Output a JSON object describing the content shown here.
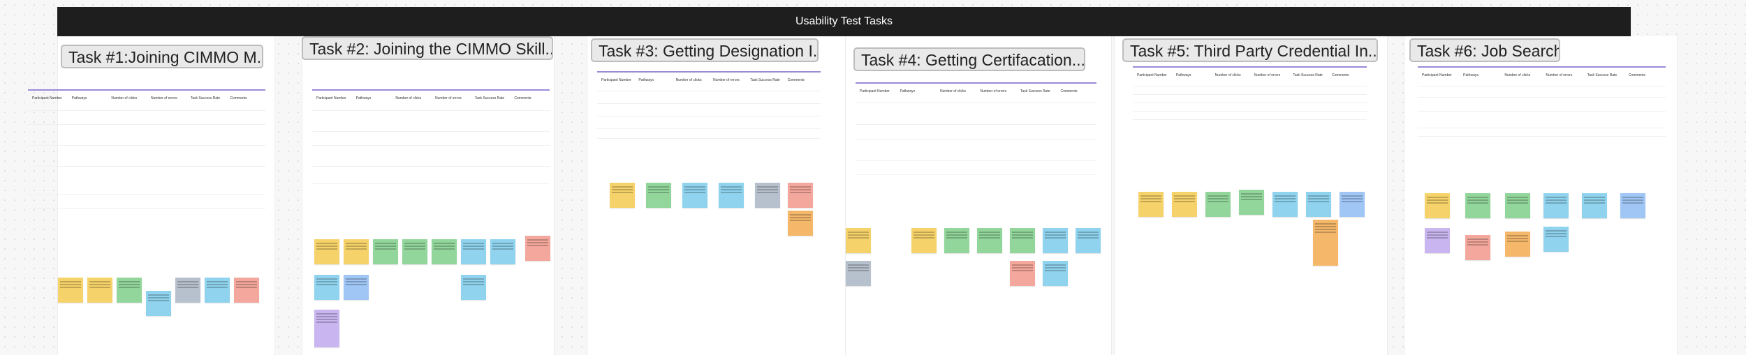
{
  "board": {
    "title": "Usability Test Tasks"
  },
  "tasks": [
    {
      "title": "Task #1:Joining CIMMO M..."
    },
    {
      "title": "Task #2: Joining the CIMMO Skill..."
    },
    {
      "title": "Task #3: Getting Designation I..."
    },
    {
      "title": "Task #4: Getting Certifacation..."
    },
    {
      "title": "Task #5: Third Party Credential In..."
    },
    {
      "title": "Task #6: Job Search"
    }
  ],
  "table_headers": [
    "Participant Number",
    "Pathways",
    "Number of clicks",
    "Number of errors",
    "Task Success Rate",
    "Comments"
  ],
  "colors": {
    "header_bg": "#1e1e1e",
    "table_accent": "#9c8ad8",
    "sticky_yellow": "#f6d36a",
    "sticky_green": "#93d69c",
    "sticky_blue": "#8fd3ee",
    "sticky_gray": "#b7c0cd",
    "sticky_red": "#f4a79c",
    "sticky_orange": "#f5b86b",
    "sticky_purple": "#c9b5ef"
  }
}
